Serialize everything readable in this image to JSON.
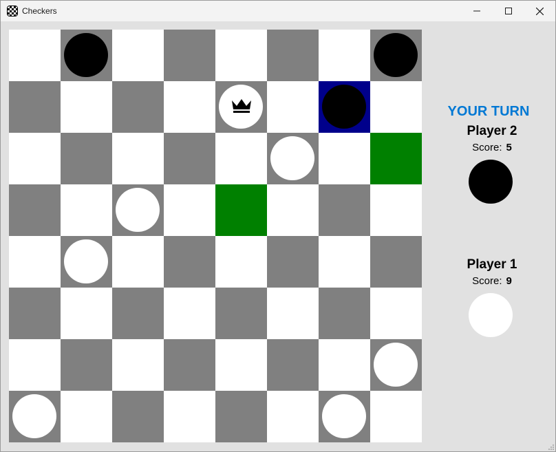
{
  "window": {
    "title": "Checkers",
    "icons": {
      "app": "checkers-board-icon",
      "minimize": "minimize-icon",
      "maximize": "maximize-icon",
      "close": "close-icon"
    }
  },
  "colors": {
    "light_square": "#ffffff",
    "dark_square": "#808080",
    "selected_square": "#00008b",
    "move_target_square": "#008000",
    "black_piece": "#000000",
    "white_piece": "#ffffff",
    "turn_text": "#0078d4",
    "panel_bg": "#e1e1e1"
  },
  "board": {
    "rows": 8,
    "cols": 8,
    "selected": {
      "row": 1,
      "col": 6
    },
    "move_targets": [
      {
        "row": 2,
        "col": 7
      },
      {
        "row": 3,
        "col": 4
      }
    ],
    "pieces": [
      {
        "row": 0,
        "col": 1,
        "color": "black",
        "king": false
      },
      {
        "row": 0,
        "col": 7,
        "color": "black",
        "king": false
      },
      {
        "row": 1,
        "col": 4,
        "color": "white",
        "king": true
      },
      {
        "row": 1,
        "col": 6,
        "color": "black",
        "king": false
      },
      {
        "row": 2,
        "col": 5,
        "color": "white",
        "king": false
      },
      {
        "row": 3,
        "col": 2,
        "color": "white",
        "king": false
      },
      {
        "row": 4,
        "col": 1,
        "color": "white",
        "king": false
      },
      {
        "row": 6,
        "col": 7,
        "color": "white",
        "king": false
      },
      {
        "row": 7,
        "col": 0,
        "color": "white",
        "king": false
      },
      {
        "row": 7,
        "col": 6,
        "color": "white",
        "king": false
      }
    ]
  },
  "side_panel": {
    "turn_label": "YOUR TURN",
    "player2": {
      "name": "Player 2",
      "score_label": "Score:",
      "score": "5",
      "piece_color": "black"
    },
    "player1": {
      "name": "Player 1",
      "score_label": "Score:",
      "score": "9",
      "piece_color": "white"
    }
  }
}
